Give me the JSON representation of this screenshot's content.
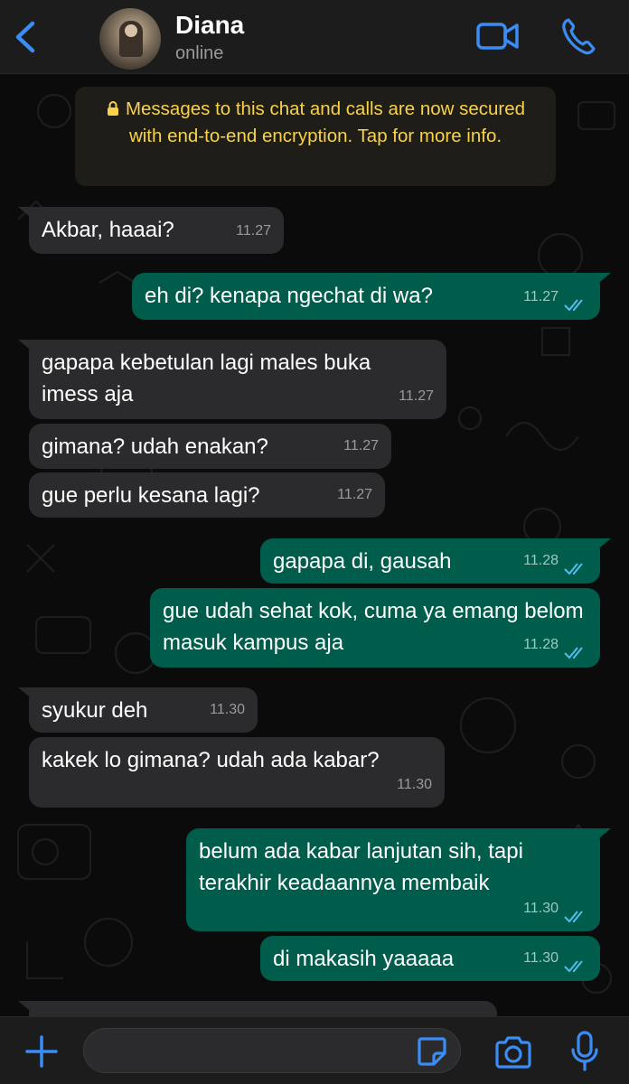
{
  "header": {
    "contact_name": "Diana",
    "status": "online",
    "back_icon": "chevron-left-icon",
    "video_icon": "video-camera-icon",
    "call_icon": "phone-icon",
    "accent_color": "#3a8df5"
  },
  "encryption_notice": {
    "icon": "lock-icon",
    "text": "Messages to this chat and calls are now secured with end-to-end encryption. Tap for more info.",
    "color": "#f7d24a"
  },
  "messages": [
    {
      "direction": "in",
      "text": "Akbar, haaai?",
      "time": "11.27"
    },
    {
      "direction": "out",
      "text": "eh di? kenapa ngechat di wa?",
      "time": "11.27",
      "status": "read"
    },
    {
      "direction": "in",
      "text": "gapapa kebetulan lagi males buka imess aja",
      "time": "11.27"
    },
    {
      "direction": "in",
      "text": "gimana? udah enakan?",
      "time": "11.27"
    },
    {
      "direction": "in",
      "text": "gue perlu kesana lagi?",
      "time": "11.27"
    },
    {
      "direction": "out",
      "text": "gapapa di, gausah",
      "time": "11.28",
      "status": "read"
    },
    {
      "direction": "out",
      "text": "gue udah sehat kok, cuma ya emang belom masuk kampus aja",
      "time": "11.28",
      "status": "read"
    },
    {
      "direction": "in",
      "text": "syukur deh",
      "time": "11.30"
    },
    {
      "direction": "in",
      "text": "kakek lo gimana? udah ada kabar?",
      "time": "11.30"
    },
    {
      "direction": "out",
      "text": "belum ada kabar lanjutan sih, tapi terakhir keadaannya membaik",
      "time": "11.30",
      "status": "read"
    },
    {
      "direction": "out",
      "text": "di makasih yaaaaa",
      "time": "11.30",
      "status": "read"
    }
  ],
  "composer": {
    "placeholder": "",
    "plus_icon": "plus-icon",
    "sticker_icon": "sticker-icon",
    "camera_icon": "camera-icon",
    "mic_icon": "microphone-icon"
  },
  "colors": {
    "incoming_bubble": "#2b2b2d",
    "outgoing_bubble": "#005c4b",
    "background": "#0b0b0b",
    "read_ticks": "#53bdeb"
  }
}
